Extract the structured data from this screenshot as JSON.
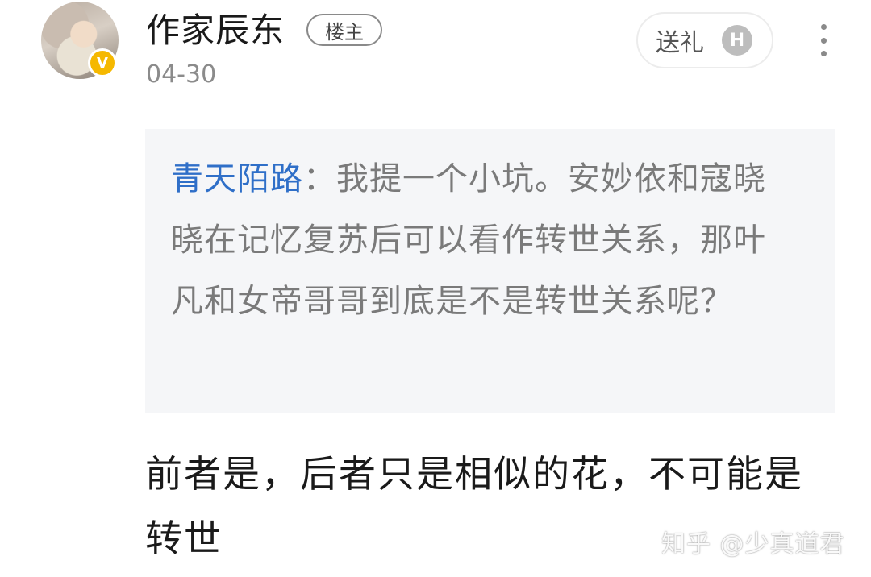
{
  "author": {
    "name": "作家辰东",
    "op_tag": "楼主",
    "date": "04-30",
    "badge": "V"
  },
  "actions": {
    "gift_label": "送礼",
    "gift_coin": "H",
    "more_icon": "more-vertical-icon"
  },
  "quote": {
    "author": "青天陌路",
    "separator": "：",
    "text": "我提一个小坑。安妙依和寇晓晓在记忆复苏后可以看作转世关系，那叶凡和女帝哥哥到底是不是转世关系呢？"
  },
  "reply": {
    "text": "前者是，后者只是相似的花，不可能是转世"
  },
  "watermark": {
    "text": "知乎 @少真道君"
  },
  "colors": {
    "link_blue": "#2f6fc8",
    "badge_gold": "#f5b800",
    "quote_bg": "#f5f6f8"
  }
}
